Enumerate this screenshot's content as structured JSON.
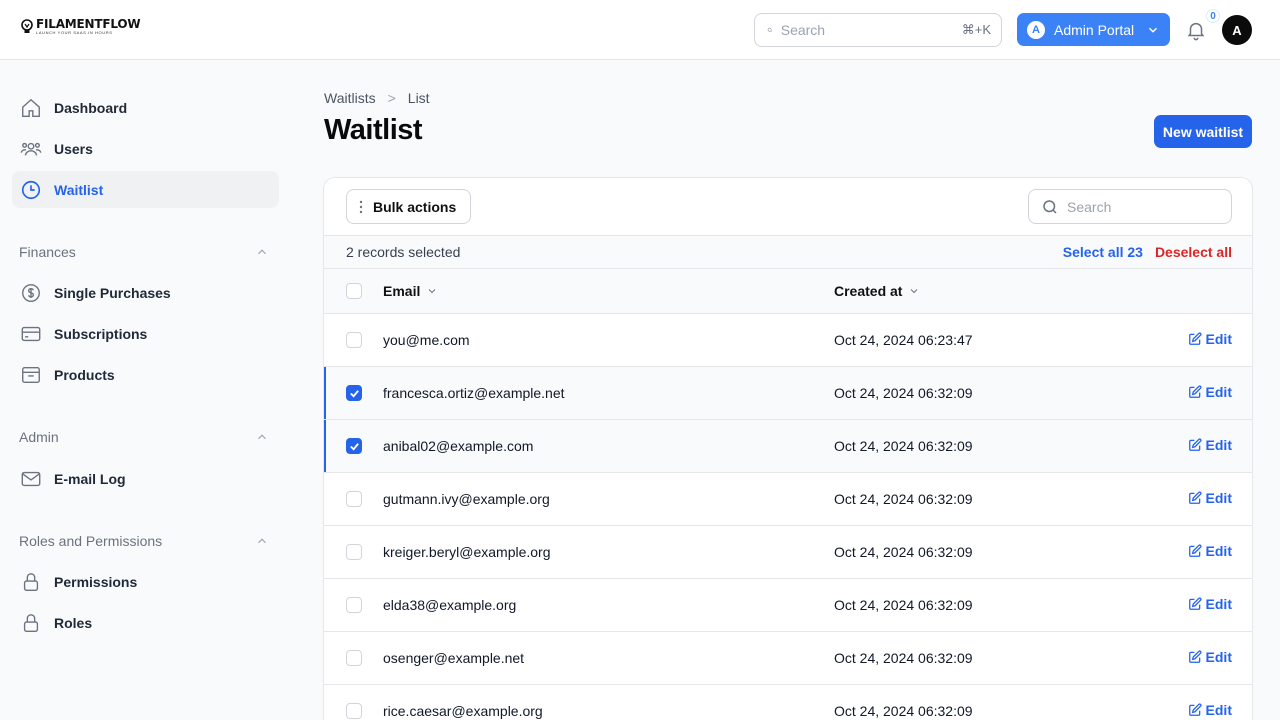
{
  "topbar": {
    "logo_text": "FILAMENTFLOW",
    "logo_tagline": "LAUNCH YOUR SAAS IN HOURS",
    "search_placeholder": "Search",
    "search_shortcut": "⌘+K",
    "portal_initial": "A",
    "portal_label": "Admin Portal",
    "notification_count": "0",
    "user_initial": "A"
  },
  "sidebar": {
    "items": [
      {
        "label": "Dashboard",
        "icon": "home-icon"
      },
      {
        "label": "Users",
        "icon": "users-icon"
      },
      {
        "label": "Waitlist",
        "icon": "clock-icon",
        "active": true
      }
    ],
    "groups": [
      {
        "label": "Finances",
        "items": [
          {
            "label": "Single Purchases",
            "icon": "dollar-icon"
          },
          {
            "label": "Subscriptions",
            "icon": "credit-card-icon"
          },
          {
            "label": "Products",
            "icon": "archive-icon"
          }
        ]
      },
      {
        "label": "Admin",
        "items": [
          {
            "label": "E-mail Log",
            "icon": "mail-icon"
          }
        ]
      },
      {
        "label": "Roles and Permissions",
        "items": [
          {
            "label": "Permissions",
            "icon": "lock-icon"
          },
          {
            "label": "Roles",
            "icon": "lock-icon"
          }
        ]
      }
    ]
  },
  "breadcrumb": {
    "parent": "Waitlists",
    "separator": ">",
    "current": "List"
  },
  "page": {
    "title": "Waitlist",
    "new_button": "New waitlist"
  },
  "table": {
    "bulk_actions_label": "Bulk actions",
    "search_placeholder": "Search",
    "selection_text": "2 records selected",
    "select_all_label": "Select all 23",
    "deselect_all_label": "Deselect all",
    "columns": [
      "Email",
      "Created at"
    ],
    "edit_label": "Edit",
    "rows": [
      {
        "email": "you@me.com",
        "created_at": "Oct 24, 2024 06:23:47",
        "selected": false
      },
      {
        "email": "francesca.ortiz@example.net",
        "created_at": "Oct 24, 2024 06:32:09",
        "selected": true
      },
      {
        "email": "anibal02@example.com",
        "created_at": "Oct 24, 2024 06:32:09",
        "selected": true
      },
      {
        "email": "gutmann.ivy@example.org",
        "created_at": "Oct 24, 2024 06:32:09",
        "selected": false
      },
      {
        "email": "kreiger.beryl@example.org",
        "created_at": "Oct 24, 2024 06:32:09",
        "selected": false
      },
      {
        "email": "elda38@example.org",
        "created_at": "Oct 24, 2024 06:32:09",
        "selected": false
      },
      {
        "email": "osenger@example.net",
        "created_at": "Oct 24, 2024 06:32:09",
        "selected": false
      },
      {
        "email": "rice.caesar@example.org",
        "created_at": "Oct 24, 2024 06:32:09",
        "selected": false
      }
    ]
  },
  "colors": {
    "primary": "#2563eb",
    "danger": "#dc2626",
    "portal": "#3b82f6"
  }
}
